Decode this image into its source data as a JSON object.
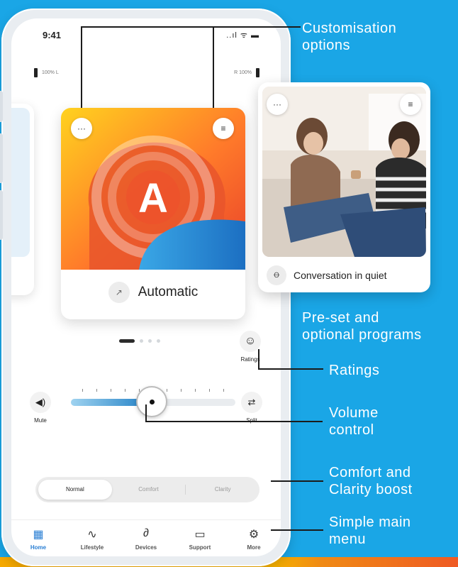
{
  "status": {
    "time": "9:41",
    "icons": "..ıl ᯤ ▬"
  },
  "battery": {
    "left": "100% L",
    "right": "R 100%"
  },
  "main_card": {
    "letter": "A",
    "mode_label": "Automatic",
    "more_glyph": "···",
    "settings_glyph": "≡"
  },
  "ratings": {
    "label": "Ratings",
    "glyph": "☺"
  },
  "volume": {
    "mute_label": "Mute",
    "split_label": "Split",
    "level_percent": 49,
    "mute_glyph": "◀)",
    "split_glyph": "⇄"
  },
  "boost": {
    "options": [
      "Normal",
      "Comfort",
      "Clarity"
    ],
    "selected": "Normal"
  },
  "tabs": [
    {
      "label": "Home",
      "glyph": "▦",
      "active": true
    },
    {
      "label": "Lifestyle",
      "glyph": "∿",
      "active": false
    },
    {
      "label": "Devices",
      "glyph": "∂",
      "active": false
    },
    {
      "label": "Support",
      "glyph": "▭",
      "active": false
    },
    {
      "label": "More",
      "glyph": "⚙",
      "active": false
    }
  ],
  "program_card": {
    "label": "Conversation in quiet",
    "icon_glyph": "Ꝋ",
    "more_glyph": "···",
    "settings_glyph": "≡"
  },
  "annotations": {
    "customisation": [
      "Customisation",
      "options"
    ],
    "programs": [
      "Pre-set and",
      "optional programs"
    ],
    "ratings": [
      "Ratings"
    ],
    "volume": [
      "Volume",
      "control"
    ],
    "boost": [
      "Comfort and",
      "Clarity boost"
    ],
    "menu": [
      "Simple main",
      "menu"
    ]
  }
}
